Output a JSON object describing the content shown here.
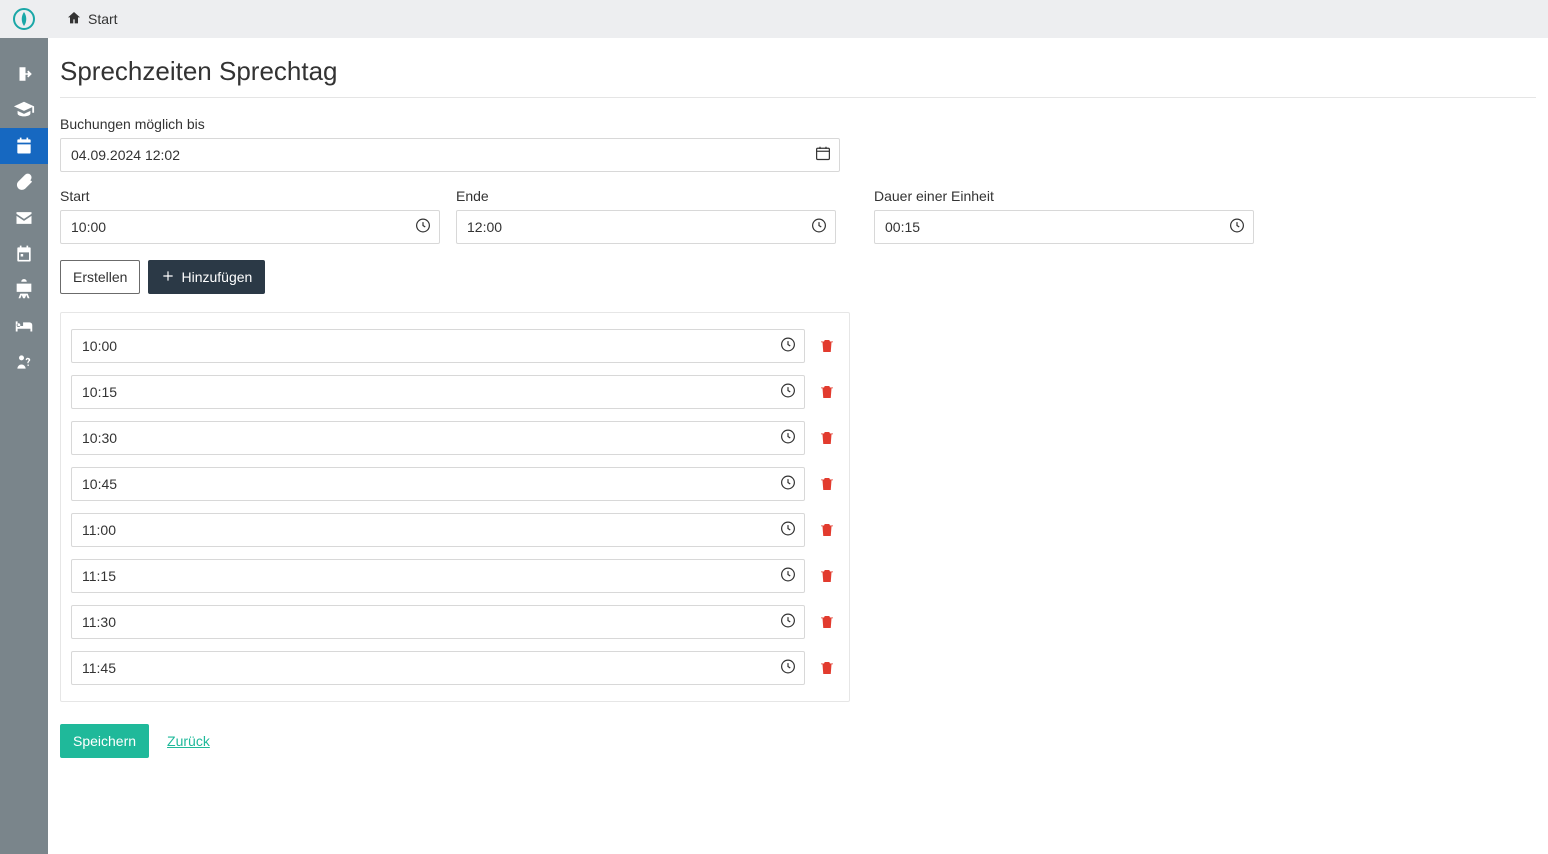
{
  "breadcrumb": {
    "home_label": "Start"
  },
  "page": {
    "title": "Sprechzeiten Sprechtag"
  },
  "sidebar": {
    "active_index": 2,
    "items": [
      {
        "name": "logout",
        "icon": "exit-icon"
      },
      {
        "name": "teachers",
        "icon": "graduation-cap-icon"
      },
      {
        "name": "consultation-days",
        "icon": "calendar-solid-icon"
      },
      {
        "name": "attachments",
        "icon": "paperclip-icon"
      },
      {
        "name": "messages",
        "icon": "envelope-icon"
      },
      {
        "name": "calendar",
        "icon": "calendar-outline-icon"
      },
      {
        "name": "training",
        "icon": "presentation-icon"
      },
      {
        "name": "stay",
        "icon": "bed-icon"
      },
      {
        "name": "help",
        "icon": "person-question-icon"
      }
    ]
  },
  "form": {
    "booking_until": {
      "label": "Buchungen möglich bis",
      "value": "04.09.2024 12:02"
    },
    "start_time": {
      "label": "Start",
      "value": "10:00"
    },
    "end_time": {
      "label": "Ende",
      "value": "12:00"
    },
    "unit_duration": {
      "label": "Dauer einer Einheit",
      "value": "00:15"
    }
  },
  "actions": {
    "create_label": "Erstellen",
    "add_label": "Hinzufügen",
    "save_label": "Speichern",
    "back_label": "Zurück"
  },
  "slots": [
    {
      "time": "10:00"
    },
    {
      "time": "10:15"
    },
    {
      "time": "10:30"
    },
    {
      "time": "10:45"
    },
    {
      "time": "11:00"
    },
    {
      "time": "11:15"
    },
    {
      "time": "11:30"
    },
    {
      "time": "11:45"
    }
  ]
}
